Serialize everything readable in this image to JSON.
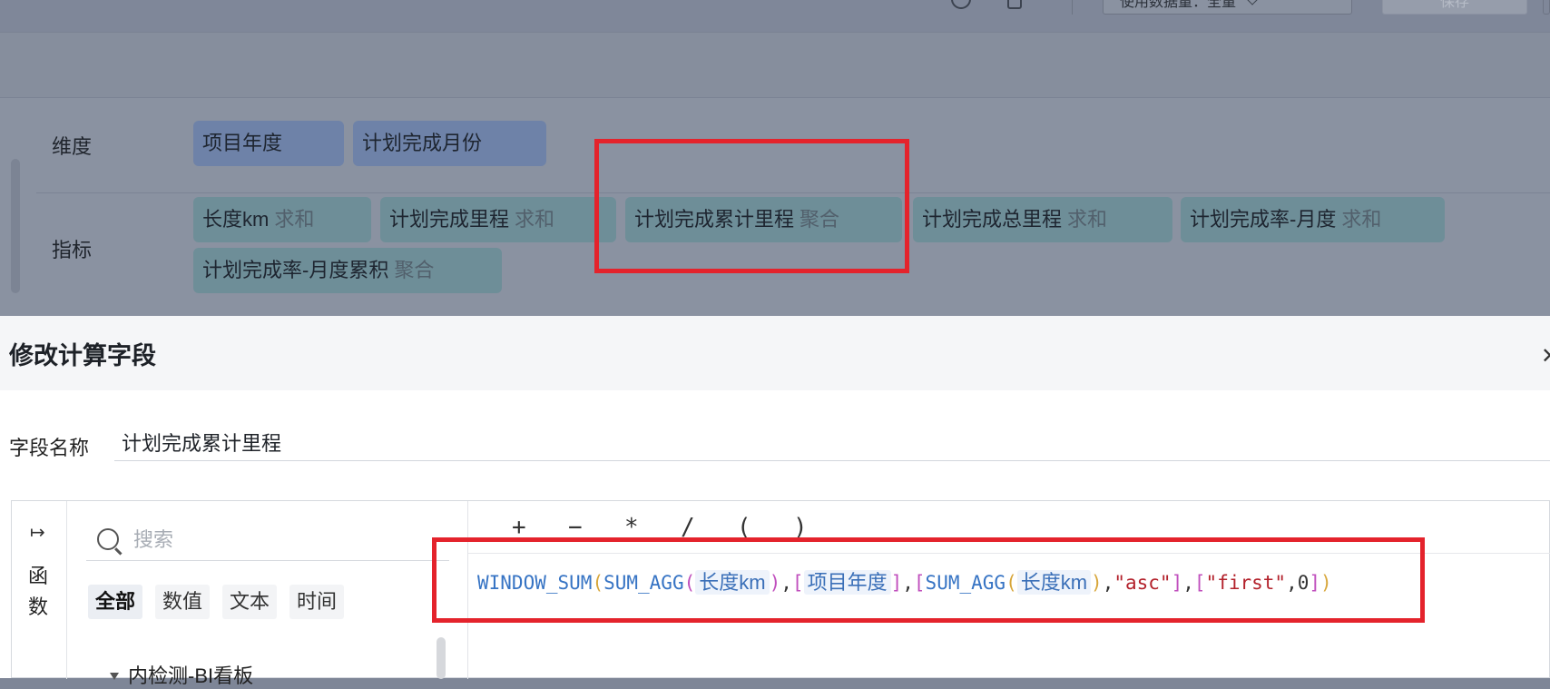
{
  "toolbar": {
    "data_usage_label": "使用数据量：全量",
    "save_label": "保存"
  },
  "dimension_row": {
    "label": "维度",
    "items": [
      "项目年度",
      "计划完成月份"
    ]
  },
  "metric_row": {
    "label": "指标",
    "items": [
      {
        "name": "长度km",
        "agg": "求和"
      },
      {
        "name": "计划完成里程",
        "agg": "求和"
      },
      {
        "name": "计划完成累计里程",
        "agg": "聚合"
      },
      {
        "name": "计划完成总里程",
        "agg": "求和"
      },
      {
        "name": "计划完成率-月度",
        "agg": "求和"
      },
      {
        "name": "计划完成率-月度累积",
        "agg": "聚合"
      }
    ]
  },
  "modal": {
    "title": "修改计算字段",
    "close_icon": "close-icon",
    "field_name_label": "字段名称",
    "field_name_value": "计划完成累计里程",
    "rail_label": "函数",
    "search_placeholder": "搜索",
    "filter_tabs": [
      "全部",
      "数值",
      "文本",
      "时间"
    ],
    "tree_item": "内检测-BI看板",
    "operators": [
      "+",
      "−",
      "*",
      "/",
      "(",
      ")"
    ],
    "formula": {
      "fn_window_sum": "WINDOW_SUM",
      "fn_sum_agg": "SUM_AGG",
      "field_length": "长度km",
      "field_year": "项目年度",
      "str_asc": "\"asc\"",
      "str_first": "\"first\"",
      "num_zero": "0"
    }
  },
  "colors": {
    "highlight": "#e4232c",
    "function": "#3774c4",
    "string": "#b3212b"
  }
}
